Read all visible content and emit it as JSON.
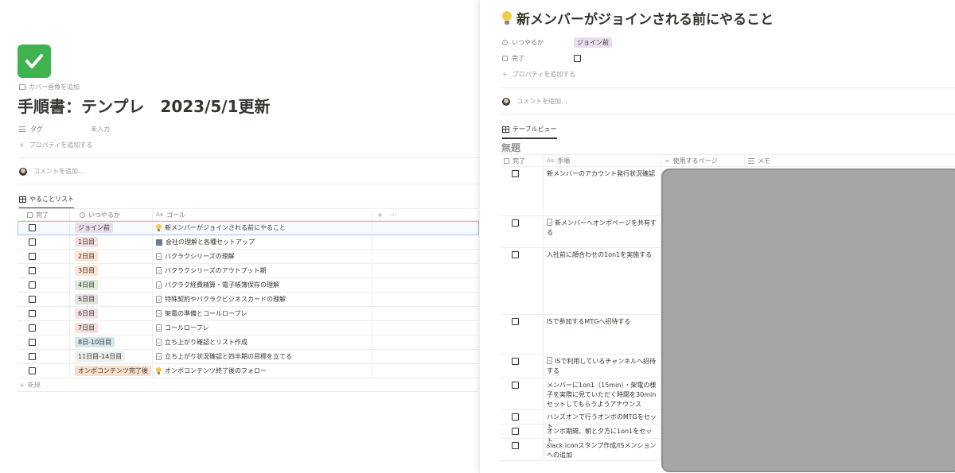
{
  "left": {
    "cover_link": "カバー画像を追加",
    "title": "手順書：テンプレ　2023/5/1更新",
    "property": {
      "name": "タグ",
      "value": "未入力"
    },
    "add_property": "プロパティを追加する",
    "comment_placeholder": "コメントを追加...",
    "view_tab": "やることリスト",
    "columns": {
      "done": "完了",
      "when": "いつやるか",
      "goal": "ゴール",
      "add": "+",
      "more": "···"
    },
    "rows": [
      {
        "tag": "ジョイン前",
        "tag_color": "#e8deee",
        "goal": "新メンバーがジョインされる前にやること",
        "icon": "bulb",
        "selected": true
      },
      {
        "tag": "1日目",
        "tag_color": "#f4dfde",
        "goal": "会社の理解と各種セットアップ",
        "icon": "building"
      },
      {
        "tag": "2日目",
        "tag_color": "#fbe4d3",
        "goal": "バクラクシリーズの理解",
        "icon": "doc"
      },
      {
        "tag": "3日目",
        "tag_color": "#fbe4d3",
        "goal": "バクラクシリーズのアウトプット期",
        "icon": "doc"
      },
      {
        "tag": "4日目",
        "tag_color": "#dbeddb",
        "goal": "バクラク経費精算・電子帳簿保存の理解",
        "icon": "doc"
      },
      {
        "tag": "5日目",
        "tag_color": "#e3e2e0",
        "goal": "特殊契約やバクラクビジネスカードの理解",
        "icon": "doc"
      },
      {
        "tag": "6日目",
        "tag_color": "#f5e0e9",
        "goal": "架電の準備とコールロープレ",
        "icon": "doc"
      },
      {
        "tag": "7日目",
        "tag_color": "#f4dfde",
        "goal": "コールロープレ",
        "icon": "doc"
      },
      {
        "tag": "8日-10日目",
        "tag_color": "#d3e5ef",
        "goal": "立ち上がり確認とリスト作成",
        "icon": "doc"
      },
      {
        "tag": "11日目-14日目",
        "tag_color": "#eeeeec",
        "goal": "立ち上がり状況確認と四半期の目標を立てる",
        "icon": "doc"
      },
      {
        "tag": "オンボコンテンツ完了後",
        "tag_color": "#fadec9",
        "goal": "オンボコンテンツ終了後のフォロー",
        "icon": "bulb"
      }
    ],
    "new_label": "新規"
  },
  "right": {
    "title": "新メンバーがジョインされる前にやること",
    "props": [
      {
        "name": "いつやるか",
        "value": "ジョイン前",
        "tag_color": "#e8deee"
      },
      {
        "name": "完了",
        "value": ""
      }
    ],
    "add_property": "プロパティを追加する",
    "comment_placeholder": "コメントを追加...",
    "view_tab": "テーブルビュー",
    "table_title": "無題",
    "columns": {
      "done": "完了",
      "step": "手順",
      "page": "使用するページ",
      "memo": "メモ"
    },
    "rows": [
      {
        "step": "新メンバーのアカウント発行状況確認",
        "icon": "",
        "height": 62
      },
      {
        "step": "新メンバーへオンボページを共有する",
        "icon": "doc",
        "height": 40
      },
      {
        "step": "入社前に顔合わせの1on1を実施する",
        "icon": "",
        "height": 84
      },
      {
        "step": "ISで参加するMTGへ招待する",
        "icon": "",
        "height": 50
      },
      {
        "step": "ISで利用しているチャンネルへ招待する",
        "icon": "doc",
        "height": 30
      },
      {
        "step": "メンバーに1on1（15min）・架電の様子を実際に見ていただく時間を30minセットしてもらうようアナウンス",
        "icon": "",
        "height": 40
      },
      {
        "step": "ハンズオンで行うオンボのMTGをセット",
        "icon": "",
        "height": 18
      },
      {
        "step": "オンボ期間、朝と夕方に1on1をセット",
        "icon": "",
        "height": 18
      },
      {
        "step": "slack iconスタンプ作成/ISメンションへの追加",
        "icon": "",
        "height": 28
      }
    ]
  }
}
